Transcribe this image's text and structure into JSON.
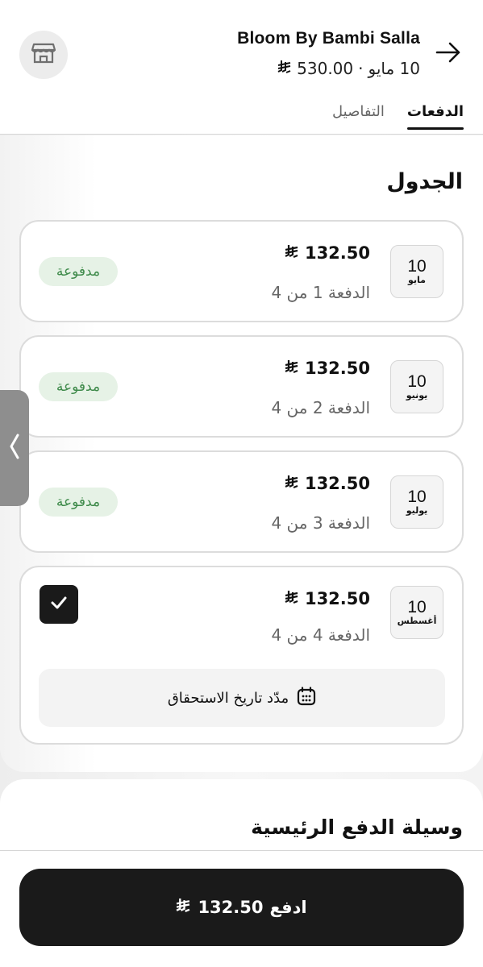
{
  "header": {
    "merchant_name": "Bloom By Bambi Salla",
    "order_date": "10 مايو",
    "separator": "·",
    "order_total": "530.00",
    "icons": {
      "store": "store-icon",
      "back": "arrow-right-icon",
      "currency": "riyal-icon"
    }
  },
  "tabs": [
    {
      "label": "الدفعات",
      "active": true
    },
    {
      "label": "التفاصيل",
      "active": false
    }
  ],
  "schedule": {
    "title": "الجدول",
    "items": [
      {
        "day": "10",
        "month": "مايو",
        "amount": "132.50",
        "installment": "الدفعة 1 من 4",
        "status": "مدفوعة"
      },
      {
        "day": "10",
        "month": "يونيو",
        "amount": "132.50",
        "installment": "الدفعة 2 من 4",
        "status": "مدفوعة"
      },
      {
        "day": "10",
        "month": "يوليو",
        "amount": "132.50",
        "installment": "الدفعة 3 من 4",
        "status": "مدفوعة"
      },
      {
        "day": "10",
        "month": "أغسطس",
        "amount": "132.50",
        "installment": "الدفعة 4 من 4",
        "status": "",
        "selected": true
      }
    ],
    "extend_label": "مدّد تاريخ الاستحقاق"
  },
  "payment_method": {
    "title": "وسيلة الدفع الرئيسية"
  },
  "pay_button": {
    "label": "ادفع",
    "amount": "132.50"
  },
  "colors": {
    "paid_badge_bg": "#e6f2e6",
    "paid_badge_text": "#3e8a4a",
    "primary": "#1a1a1a"
  }
}
